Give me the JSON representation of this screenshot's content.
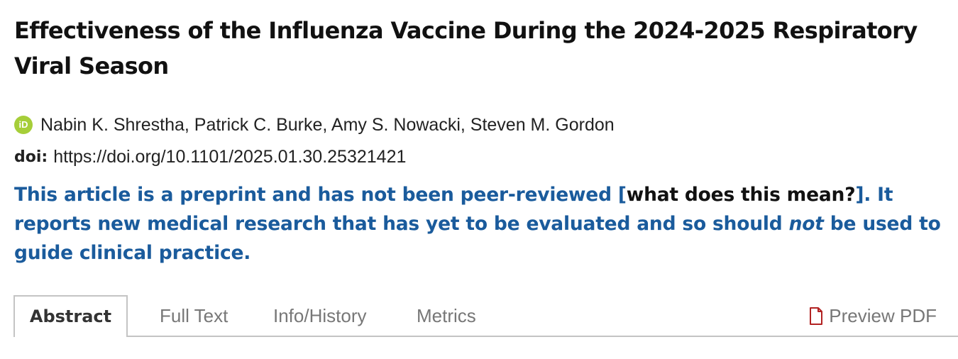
{
  "article": {
    "title": "Effectiveness of the Influenza Vaccine During the 2024-2025 Respiratory Viral Season",
    "authors": "Nabin K. Shrestha, Patrick C. Burke, Amy S. Nowacki, Steven M. Gordon",
    "orcid_badge": "iD",
    "doi_label": "doi:",
    "doi_value": "https://doi.org/10.1101/2025.01.30.25321421"
  },
  "notice": {
    "part1": "This article is a preprint and has not been peer-reviewed [",
    "link": "what does this mean?",
    "part2": "]. It reports new medical research that has yet to be evaluated and so should ",
    "emphasis": "not",
    "part3": " be used to guide clinical practice."
  },
  "tabs": [
    {
      "label": "Abstract"
    },
    {
      "label": "Full Text"
    },
    {
      "label": "Info/History"
    },
    {
      "label": "Metrics"
    }
  ],
  "preview_pdf": {
    "label": "Preview PDF",
    "icon": "pdf-file-icon"
  },
  "colors": {
    "notice_blue": "#1a5b9c",
    "orcid_green": "#a6ce39",
    "pdf_red": "#b22222"
  }
}
